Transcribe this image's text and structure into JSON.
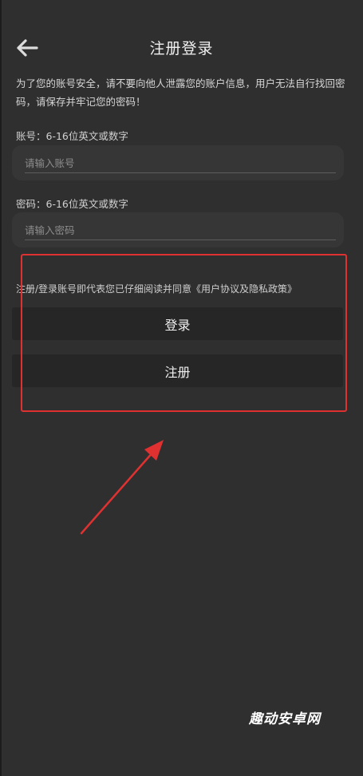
{
  "header": {
    "title": "注册登录",
    "back_icon": "arrow-left-icon"
  },
  "notice": "为了您的账号安全，请不要向他人泄露您的账户信息，用户无法自行找回密码，请保存并牢记您的密码！",
  "account": {
    "label": "账号：6-16位英文或数字",
    "placeholder": "请输入账号",
    "value": ""
  },
  "password": {
    "label": "密码：6-16位英文或数字",
    "placeholder": "请输入密码",
    "value": ""
  },
  "agreement": "注册/登录账号即代表您已仔细阅读并同意《用户协议及隐私政策》",
  "buttons": {
    "login": "登录",
    "register": "注册"
  },
  "annotation": {
    "highlight_color": "#e03131"
  },
  "watermark": "趣动安卓网"
}
